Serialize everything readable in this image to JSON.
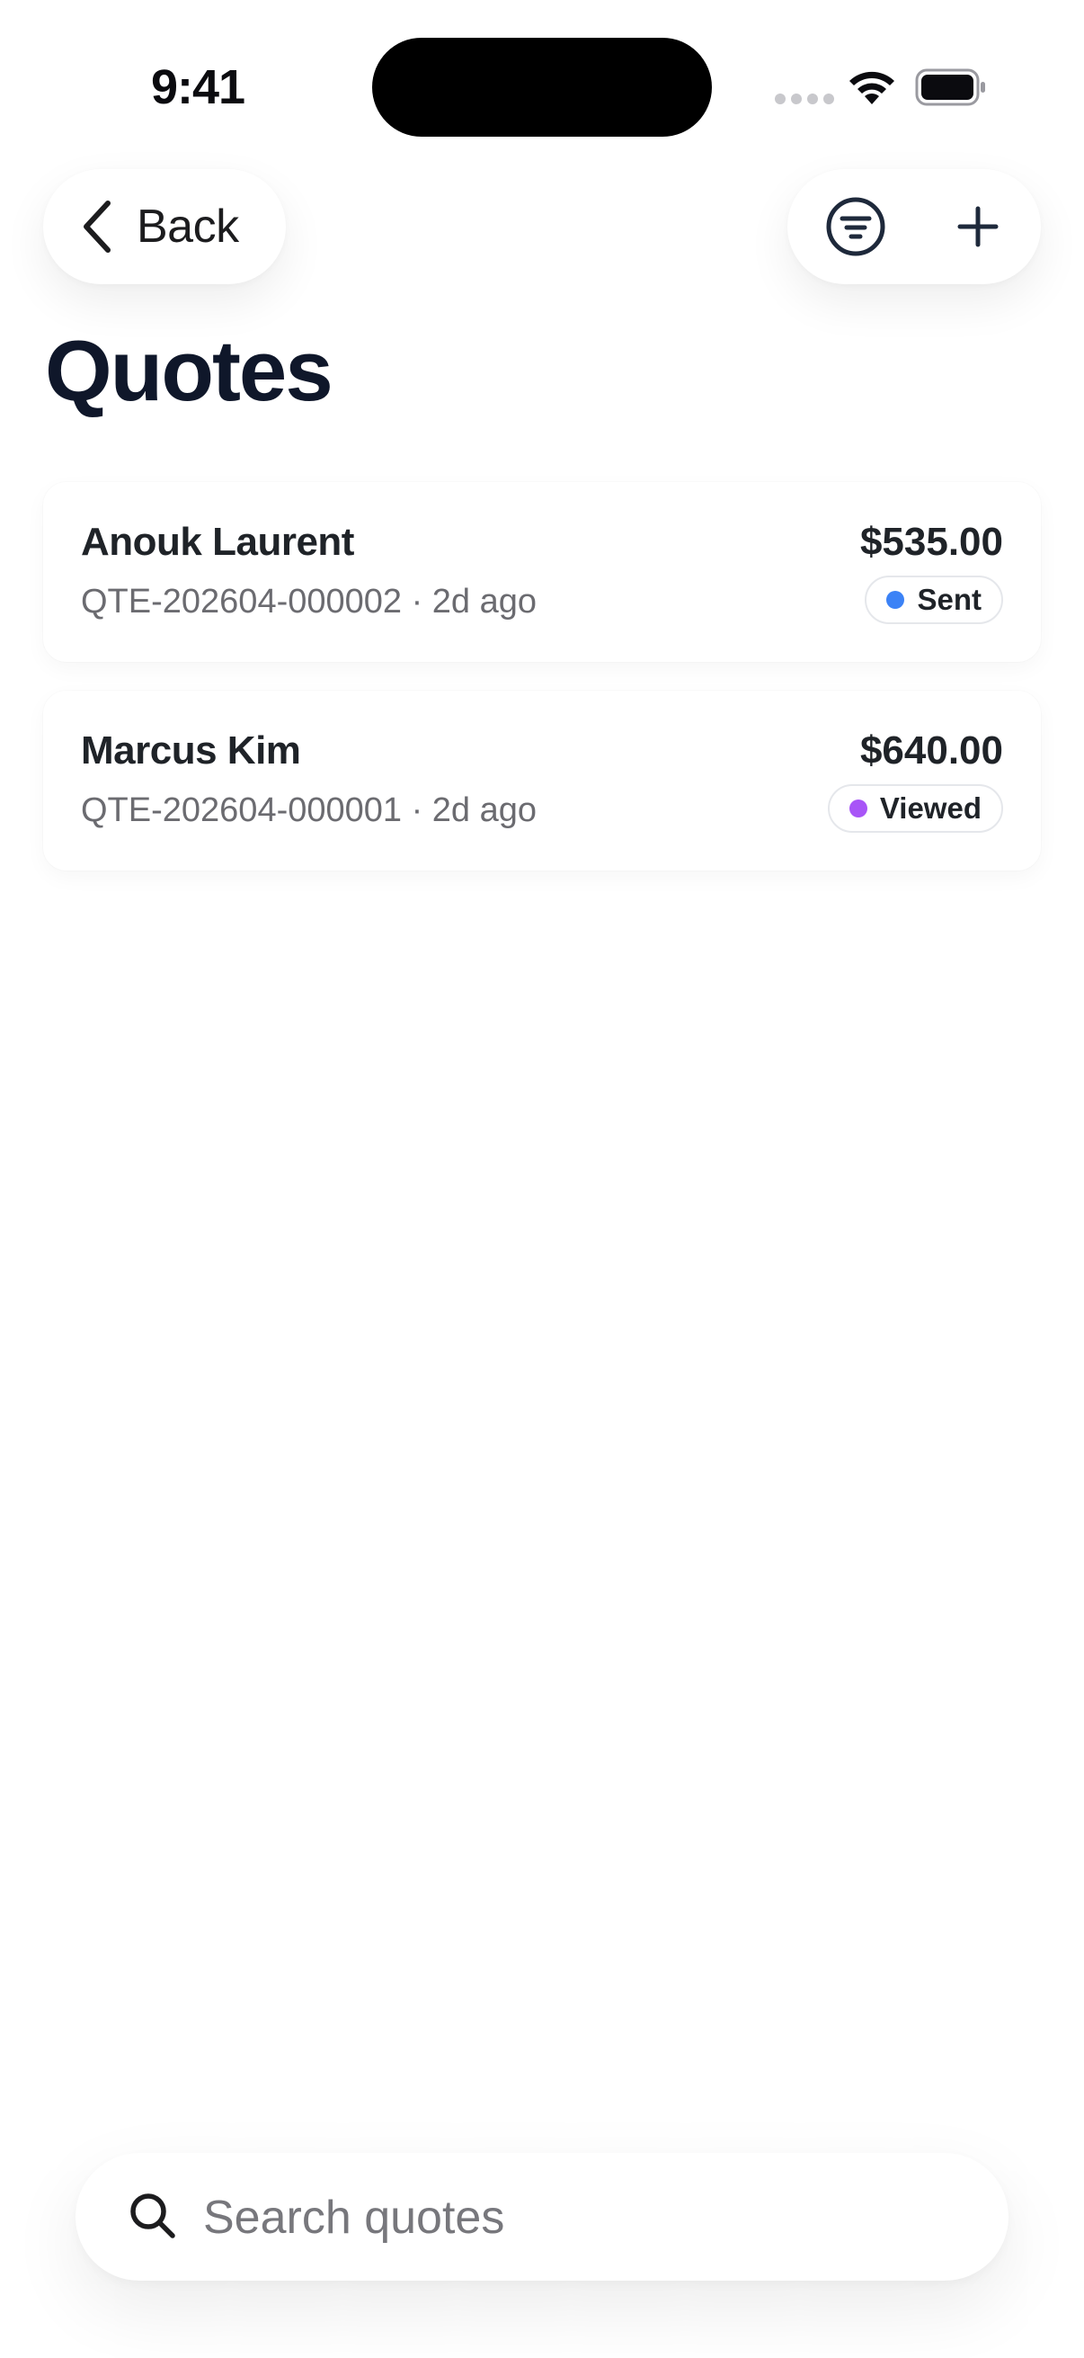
{
  "status_bar": {
    "time": "9:41"
  },
  "nav": {
    "back_label": "Back"
  },
  "page": {
    "title": "Quotes"
  },
  "quotes": [
    {
      "customer": "Anouk Laurent",
      "number": "QTE-202604-000002",
      "age": "2d ago",
      "meta": "QTE-202604-000002 · 2d ago",
      "amount": "$535.00",
      "status": "Sent",
      "status_color": "#3b82f6"
    },
    {
      "customer": "Marcus Kim",
      "number": "QTE-202604-000001",
      "age": "2d ago",
      "meta": "QTE-202604-000001 · 2d ago",
      "amount": "$640.00",
      "status": "Viewed",
      "status_color": "#a855f7"
    }
  ],
  "search": {
    "placeholder": "Search quotes",
    "value": ""
  }
}
